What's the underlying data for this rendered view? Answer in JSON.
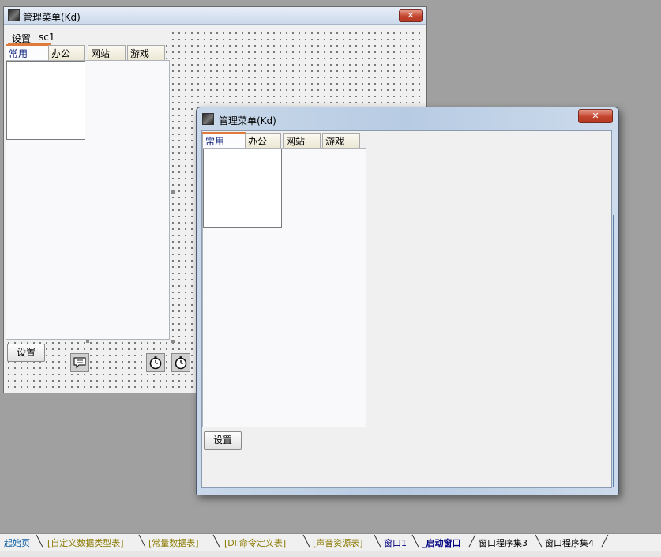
{
  "designer_window": {
    "title": "管理菜单(Kd)",
    "close_glyph": "✕",
    "menu": [
      "设置",
      "sc1"
    ],
    "tabs": [
      "常用",
      "办公",
      "网站",
      "游戏"
    ],
    "button_label": "设置",
    "components": [
      "chat-bubble-icon",
      "stopwatch-icon",
      "stopwatch-icon"
    ]
  },
  "runtime_window": {
    "title": "管理菜单(Kd)",
    "close_glyph": "✕",
    "tabs": [
      "常用",
      "办公",
      "网站",
      "游戏"
    ],
    "button_label": "设置"
  },
  "bottom_tabs": [
    {
      "label": "起始页",
      "color": "#0b5fa5"
    },
    {
      "label": "[自定义数据类型表]",
      "color": "#8a7a00"
    },
    {
      "label": "[常量数据表]",
      "color": "#8a7a00"
    },
    {
      "label": "[Dll命令定义表]",
      "color": "#8a7a00"
    },
    {
      "label": "[声音资源表]",
      "color": "#8a7a00"
    },
    {
      "label": "窗口1",
      "color": "#000080"
    },
    {
      "label": "_启动窗口",
      "color": "#000080",
      "active": true
    },
    {
      "label": "窗口程序集3",
      "color": "#000000"
    },
    {
      "label": "窗口程序集4",
      "color": "#000000"
    }
  ],
  "colors": {
    "accent": "#e07a3a",
    "active_tab_text": "#0b1f7a",
    "close_button": "#c4432c"
  }
}
